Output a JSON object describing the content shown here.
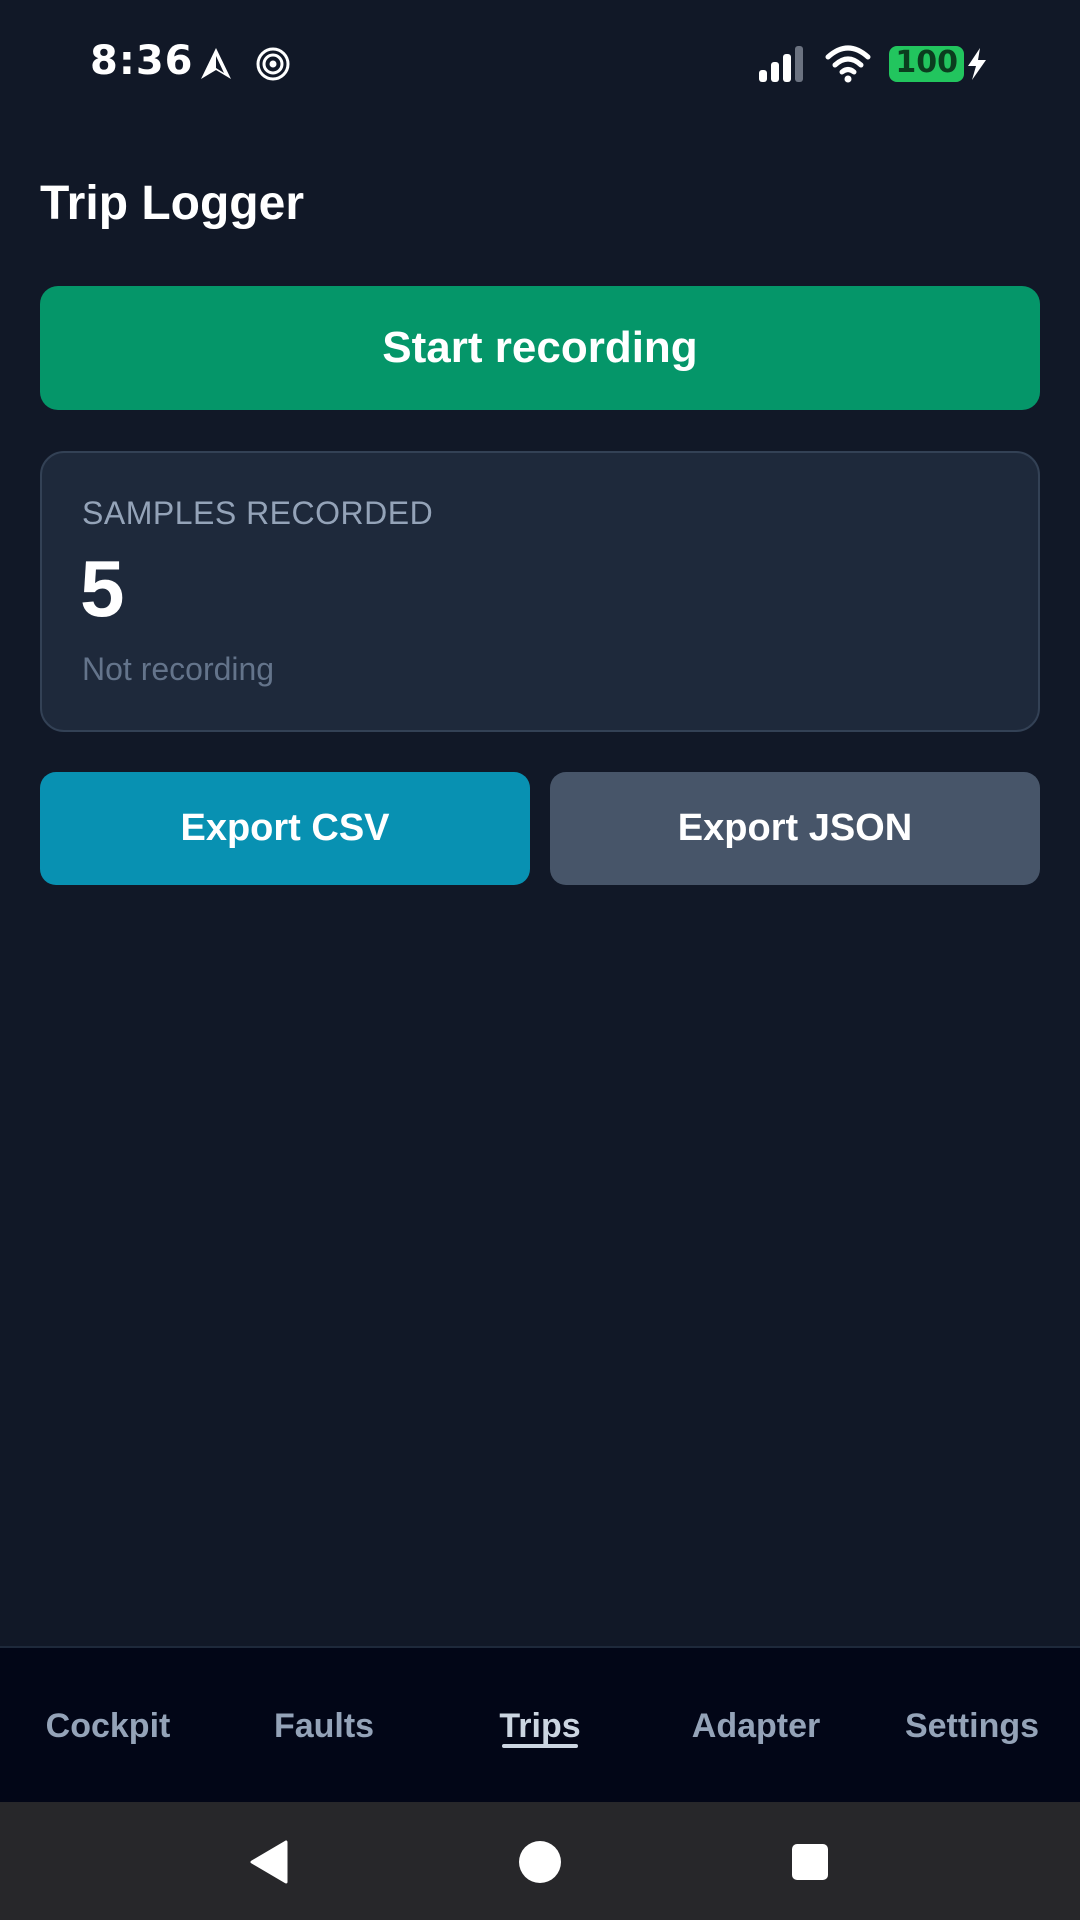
{
  "status_bar": {
    "time": "8:36",
    "battery": "100",
    "icons": [
      "navigation-arrow-icon",
      "hotspot-icon",
      "signal-icon",
      "wifi-icon",
      "battery-icon",
      "charging-bolt-icon"
    ]
  },
  "page": {
    "title": "Trip Logger"
  },
  "actions": {
    "start_label": "Start recording",
    "export_csv_label": "Export CSV",
    "export_json_label": "Export JSON"
  },
  "samples_card": {
    "label": "SAMPLES RECORDED",
    "count": "5",
    "status": "Not recording"
  },
  "tabs": [
    {
      "label": "Cockpit",
      "active": false
    },
    {
      "label": "Faults",
      "active": false
    },
    {
      "label": "Trips",
      "active": true
    },
    {
      "label": "Adapter",
      "active": false
    },
    {
      "label": "Settings",
      "active": false
    }
  ],
  "colors": {
    "background": "#111827",
    "start_button": "#059669",
    "export_csv": "#0891b2",
    "export_json": "#475569",
    "battery": "#22c55e"
  }
}
